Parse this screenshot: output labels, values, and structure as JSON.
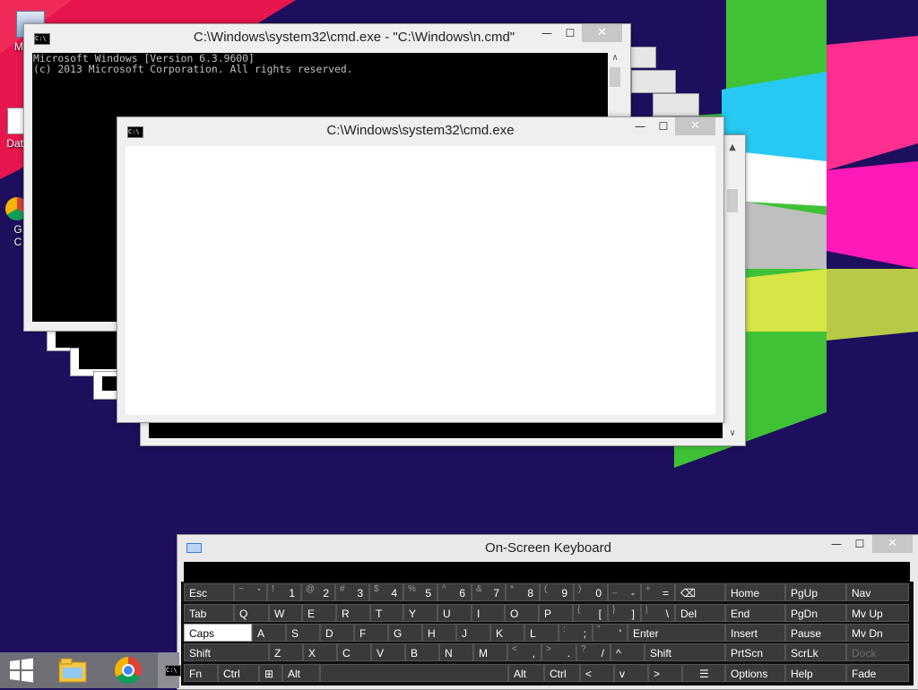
{
  "desktop": {
    "icons": [
      {
        "label": "My C"
      },
      {
        "label": "Data"
      },
      {
        "label": "G"
      },
      {
        "label": "C"
      }
    ]
  },
  "windows": {
    "back_cmd": {
      "title": "C:\\Windows\\system32\\cmd.exe - \"C:\\Windows\\n.cmd\"",
      "console_lines": [
        "Microsoft Windows [Version 6.3.9600]",
        "(c) 2013 Microsoft Corporation. All rights reserved."
      ]
    },
    "front_cmd": {
      "title": "C:\\Windows\\system32\\cmd.exe"
    },
    "buttons": {
      "minimize": "—",
      "maximize": "☐",
      "close": "✕"
    }
  },
  "osk": {
    "title": "On-Screen Keyboard",
    "rows": [
      [
        {
          "main": "Esc"
        },
        {
          "shift": "~",
          "main": "`"
        },
        {
          "shift": "!",
          "main": "1"
        },
        {
          "shift": "@",
          "main": "2"
        },
        {
          "shift": "#",
          "main": "3"
        },
        {
          "shift": "$",
          "main": "4"
        },
        {
          "shift": "%",
          "main": "5"
        },
        {
          "shift": "^",
          "main": "6"
        },
        {
          "shift": "&",
          "main": "7"
        },
        {
          "shift": "*",
          "main": "8"
        },
        {
          "shift": "(",
          "main": "9"
        },
        {
          "shift": ")",
          "main": "0"
        },
        {
          "shift": "_",
          "main": "-"
        },
        {
          "shift": "+",
          "main": "="
        },
        {
          "main": "⌫"
        }
      ],
      [
        {
          "main": "Tab"
        },
        {
          "main": "Q"
        },
        {
          "main": "W"
        },
        {
          "main": "E"
        },
        {
          "main": "R"
        },
        {
          "main": "T"
        },
        {
          "main": "Y"
        },
        {
          "main": "U"
        },
        {
          "main": "I"
        },
        {
          "main": "O"
        },
        {
          "main": "P"
        },
        {
          "shift": "{",
          "main": "["
        },
        {
          "shift": "}",
          "main": "]"
        },
        {
          "shift": "|",
          "main": "\\"
        },
        {
          "main": "Del"
        }
      ],
      [
        {
          "main": "Caps"
        },
        {
          "main": "A"
        },
        {
          "main": "S"
        },
        {
          "main": "D"
        },
        {
          "main": "F"
        },
        {
          "main": "G"
        },
        {
          "main": "H"
        },
        {
          "main": "J"
        },
        {
          "main": "K"
        },
        {
          "main": "L"
        },
        {
          "shift": ":",
          "main": ";"
        },
        {
          "shift": "\"",
          "main": "'"
        },
        {
          "main": "Enter"
        }
      ],
      [
        {
          "main": "Shift"
        },
        {
          "main": "Z"
        },
        {
          "main": "X"
        },
        {
          "main": "C"
        },
        {
          "main": "V"
        },
        {
          "main": "B"
        },
        {
          "main": "N"
        },
        {
          "main": "M"
        },
        {
          "shift": "<",
          "main": ","
        },
        {
          "shift": ">",
          "main": "."
        },
        {
          "shift": "?",
          "main": "/"
        },
        {
          "main": "^"
        },
        {
          "main": "Shift"
        }
      ],
      [
        {
          "main": "Fn"
        },
        {
          "main": "Ctrl"
        },
        {
          "main": "windows-icon"
        },
        {
          "main": "Alt"
        },
        {
          "main": ""
        },
        {
          "main": "Alt"
        },
        {
          "main": "Ctrl"
        },
        {
          "main": "<"
        },
        {
          "main": "v"
        },
        {
          "main": ">"
        },
        {
          "main": "menu-icon"
        }
      ]
    ],
    "nav_keys": [
      [
        "Home",
        "PgUp",
        "Nav"
      ],
      [
        "End",
        "PgDn",
        "Mv Up"
      ],
      [
        "Insert",
        "Pause",
        "Mv Dn"
      ],
      [
        "PrtScn",
        "ScrLk",
        "Dock"
      ],
      [
        "Options",
        "Help",
        "Fade"
      ]
    ],
    "selected_key": "Caps",
    "disabled_key": "Dock"
  },
  "taskbar": {
    "items": [
      {
        "name": "start-button",
        "icon": "windows-logo-icon"
      },
      {
        "name": "file-explorer",
        "icon": "folder-icon"
      },
      {
        "name": "chrome",
        "icon": "chrome-icon"
      },
      {
        "name": "cmd",
        "icon": "cmd-icon"
      }
    ]
  },
  "colors": {
    "desktop_bg": "#1e0f5e",
    "osk_keys": "#3a3a3a",
    "selected_key": "#ffffff",
    "close_button": "#c7c7c7"
  }
}
